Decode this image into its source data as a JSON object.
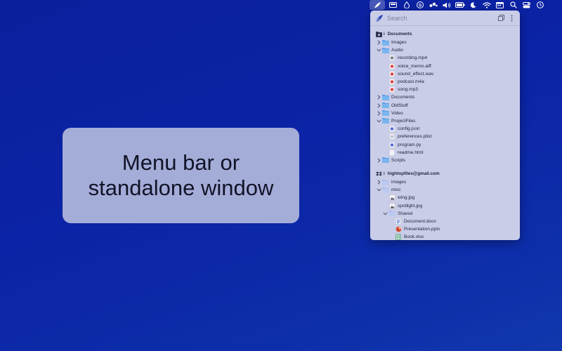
{
  "menubar": {
    "items": [
      {
        "icon": "feather-icon",
        "active": true
      },
      {
        "icon": "display-icon"
      },
      {
        "icon": "drop-icon"
      },
      {
        "icon": "s-circle-icon"
      },
      {
        "icon": "dots-icon"
      },
      {
        "icon": "speaker-icon"
      },
      {
        "icon": "battery-icon"
      },
      {
        "icon": "moon-icon"
      },
      {
        "icon": "wifi-icon"
      },
      {
        "icon": "calendar-icon"
      },
      {
        "icon": "search-icon"
      },
      {
        "icon": "control-center-icon"
      },
      {
        "icon": "clock-icon"
      }
    ]
  },
  "callout": {
    "line1": "Menu bar or",
    "line2": "standalone window"
  },
  "panel": {
    "search_placeholder": "Search",
    "sections": [
      {
        "title": "Documents",
        "info": "i",
        "source_icon": "folder-drive-icon",
        "rows": [
          {
            "label": "Images",
            "depth": 0,
            "type": "folder",
            "expanded": false
          },
          {
            "label": "Audio",
            "depth": 0,
            "type": "folder",
            "expanded": true
          },
          {
            "label": "recording.mp4",
            "depth": 1,
            "type": "file",
            "icon": "video-file-icon",
            "color": "#7d7f8c"
          },
          {
            "label": "voice_memo.aiff",
            "depth": 1,
            "type": "file",
            "icon": "audio-file-icon",
            "color": "#e0443e"
          },
          {
            "label": "sound_effect.wav",
            "depth": 1,
            "type": "file",
            "icon": "audio-file-icon",
            "color": "#e0443e"
          },
          {
            "label": "podcast.m4a",
            "depth": 1,
            "type": "file",
            "icon": "audio-file-icon",
            "color": "#e0443e"
          },
          {
            "label": "song.mp3",
            "depth": 1,
            "type": "file",
            "icon": "audio-file-icon",
            "color": "#e0443e"
          },
          {
            "label": "Documents",
            "depth": 0,
            "type": "folder",
            "expanded": false
          },
          {
            "label": "OldStuff",
            "depth": 0,
            "type": "folder",
            "expanded": false
          },
          {
            "label": "Video",
            "depth": 0,
            "type": "folder",
            "expanded": false
          },
          {
            "label": "ProjectFiles",
            "depth": 0,
            "type": "folder",
            "expanded": true
          },
          {
            "label": "config.json",
            "depth": 1,
            "type": "file",
            "icon": "json-file-icon",
            "color": "#4e6fd0"
          },
          {
            "label": "preferences.plist",
            "depth": 1,
            "type": "file",
            "icon": "plist-file-icon",
            "color": "#9a9cae"
          },
          {
            "label": "program.py",
            "depth": 1,
            "type": "file",
            "icon": "python-file-icon",
            "color": "#4e6fd0"
          },
          {
            "label": "readme.html",
            "depth": 1,
            "type": "file",
            "icon": "html-file-icon",
            "color": "#f4f4f8"
          },
          {
            "label": "Scripts",
            "depth": 0,
            "type": "folder",
            "expanded": false
          }
        ]
      },
      {
        "title": "hightopfiles@gmail.com",
        "info": "i",
        "source_icon": "dropbox-icon",
        "rows": [
          {
            "label": "images",
            "depth": 0,
            "type": "folder",
            "expanded": false,
            "light": true
          },
          {
            "label": "misc",
            "depth": 0,
            "type": "folder",
            "expanded": true,
            "light": true
          },
          {
            "label": "wing.jpg",
            "depth": 1,
            "type": "file",
            "icon": "image-file-icon",
            "color": "#f4f4f8"
          },
          {
            "label": "spotlight.jpg",
            "depth": 1,
            "type": "file",
            "icon": "image-file-icon",
            "color": "#f4f4f8"
          },
          {
            "label": "Shared",
            "depth": 1,
            "type": "folder",
            "expanded": true,
            "light": true
          },
          {
            "label": "Document.docx",
            "depth": 2,
            "type": "file",
            "icon": "word-file-icon",
            "color": "#3b6bd6"
          },
          {
            "label": "Presentation.pptx",
            "depth": 2,
            "type": "file",
            "icon": "powerpoint-file-icon",
            "color": "#d24726"
          },
          {
            "label": "Book.xlsx",
            "depth": 2,
            "type": "file",
            "icon": "excel-file-icon",
            "color": "#1f8a4c"
          }
        ]
      }
    ]
  }
}
